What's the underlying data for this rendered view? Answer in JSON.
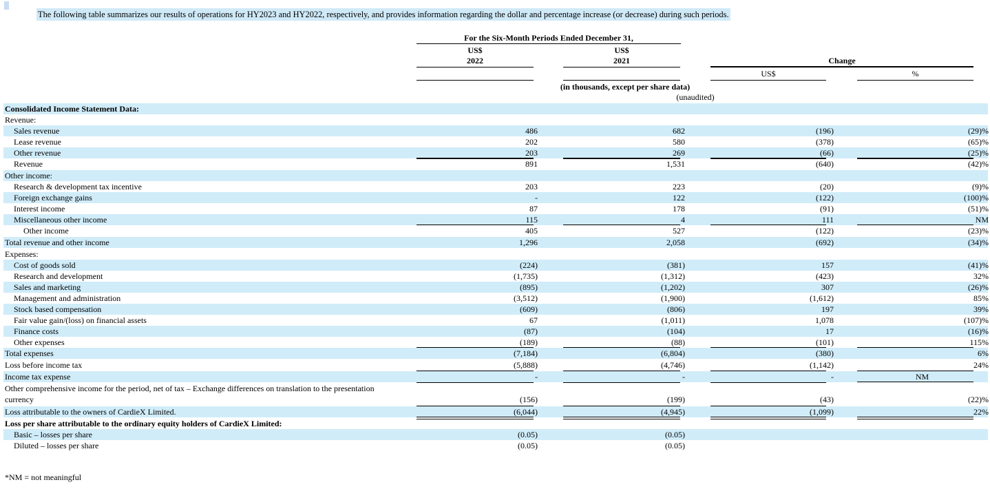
{
  "intro": "The following table summarizes our results of operations for HY2023 and HY2022, respectively, and provides information regarding the dollar and percentage increase (or decrease) during such periods.",
  "header": {
    "period_title": "For the Six-Month Periods Ended December 31,",
    "col1_currency": "US$",
    "col1_year": "2022",
    "col2_currency": "US$",
    "col2_year": "2021",
    "change_title": "Change",
    "change_usd": "US$",
    "change_pct": "%",
    "units": "(in thousands, except per share data)",
    "unaudited": "(unaudited)"
  },
  "rows": [
    {
      "label": "Consolidated Income Statement Data:",
      "bold": true,
      "indent": 0,
      "shaded": true,
      "v": [
        "",
        "",
        "",
        ""
      ]
    },
    {
      "label": "Revenue:",
      "indent": 0,
      "v": [
        "",
        "",
        "",
        ""
      ]
    },
    {
      "label": "Sales revenue",
      "indent": 1,
      "shaded": true,
      "v": [
        "486",
        "682",
        "(196)",
        "(29)%"
      ]
    },
    {
      "label": "Lease revenue",
      "indent": 1,
      "v": [
        "202",
        "580",
        "(378)",
        "(65)%"
      ]
    },
    {
      "label": "Other revenue",
      "indent": 1,
      "shaded": true,
      "v": [
        "203",
        "269",
        "(66)",
        "(25)%"
      ]
    },
    {
      "label": "Revenue",
      "indent": 1,
      "v": [
        "891",
        "1,531",
        "(640)",
        "(42)%"
      ]
    },
    {
      "label": "Other income:",
      "indent": 0,
      "shaded": true,
      "v": [
        "",
        "",
        "",
        ""
      ]
    },
    {
      "label": "Research & development tax incentive",
      "indent": 1,
      "v": [
        "203",
        "223",
        "(20)",
        "(9)%"
      ]
    },
    {
      "label": "Foreign exchange gains",
      "indent": 1,
      "shaded": true,
      "v": [
        "-",
        "122",
        "(122)",
        "(100)%"
      ]
    },
    {
      "label": "Interest income",
      "indent": 1,
      "v": [
        "87",
        "178",
        "(91)",
        "(51)%"
      ]
    },
    {
      "label": "Miscellaneous other income",
      "indent": 1,
      "shaded": true,
      "v": [
        "115",
        "4",
        "111",
        "NM"
      ]
    },
    {
      "label": "Other income",
      "indent": 2,
      "v": [
        "405",
        "527",
        "(122)",
        "(23)%"
      ]
    },
    {
      "label": "Total revenue and other income",
      "indent": 0,
      "shaded": true,
      "v": [
        "1,296",
        "2,058",
        "(692)",
        "(34)%"
      ]
    },
    {
      "label": "Expenses:",
      "indent": 0,
      "v": [
        "",
        "",
        "",
        ""
      ]
    },
    {
      "label": "Cost of goods sold",
      "indent": 1,
      "shaded": true,
      "v": [
        "(224)",
        "(381)",
        "157",
        "(41)%"
      ]
    },
    {
      "label": "Research and development",
      "indent": 1,
      "v": [
        "(1,735)",
        "(1,312)",
        "(423)",
        "32%"
      ]
    },
    {
      "label": "Sales and marketing",
      "indent": 1,
      "shaded": true,
      "v": [
        "(895)",
        "(1,202)",
        "307",
        "(26)%"
      ]
    },
    {
      "label": "Management and administration",
      "indent": 1,
      "v": [
        "(3,512)",
        "(1,900)",
        "(1,612)",
        "85%"
      ]
    },
    {
      "label": "Stock based compensation",
      "indent": 1,
      "shaded": true,
      "v": [
        "(609)",
        "(806)",
        "197",
        "39%"
      ]
    },
    {
      "label": "Fair value gain/(loss) on financial assets",
      "indent": 1,
      "v": [
        "67",
        "(1,011)",
        "1,078",
        "(107)%"
      ]
    },
    {
      "label": "Finance costs",
      "indent": 1,
      "shaded": true,
      "v": [
        "(87)",
        "(104)",
        "17",
        "(16)%"
      ]
    },
    {
      "label": "Other expenses",
      "indent": 1,
      "v": [
        "(189)",
        "(88)",
        "(101)",
        "115%"
      ]
    },
    {
      "label": "Total expenses",
      "indent": 0,
      "shaded": true,
      "v": [
        "(7,184)",
        "(6,804)",
        "(380)",
        "6%"
      ]
    },
    {
      "label": "Loss before income tax",
      "indent": 0,
      "v": [
        "(5,888)",
        "(4,746)",
        "(1,142)",
        "24%"
      ]
    },
    {
      "label": "Income tax expense",
      "indent": 0,
      "shaded": true,
      "v": [
        "-",
        "-",
        "-",
        "NM"
      ]
    },
    {
      "label": "Other comprehensive income for the period, net of tax – Exchange differences on translation to the presentation currency",
      "indent": 0,
      "tall": true,
      "v": [
        "(156)",
        "(199)",
        "(43)",
        "(22)%"
      ]
    },
    {
      "label": "Loss attributable to the owners of CardieX Limited.",
      "indent": 0,
      "shaded": true,
      "v": [
        "(6,044)",
        "(4,945)",
        "(1,099)",
        "22%"
      ]
    },
    {
      "label": "Loss per share attributable to the ordinary equity holders of CardieX Limited:",
      "bold": true,
      "indent": 0,
      "v": [
        "",
        "",
        "",
        ""
      ]
    },
    {
      "label": "Basic – losses per share",
      "indent": 1,
      "shaded": true,
      "v": [
        "(0.05)",
        "(0.05)",
        "",
        ""
      ]
    },
    {
      "label": "Diluted – losses per share",
      "indent": 1,
      "v": [
        "(0.05)",
        "(0.05)",
        "",
        ""
      ]
    }
  ],
  "footnote": "*NM = not meaningful"
}
